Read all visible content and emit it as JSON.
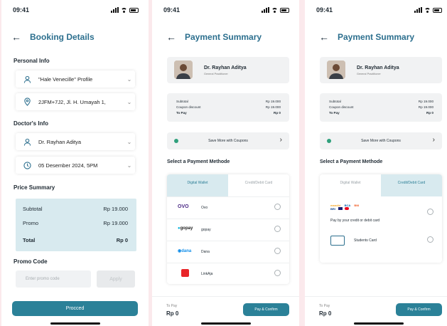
{
  "status": {
    "time": "09:41"
  },
  "booking": {
    "title": "Booking Details",
    "personal_info_label": "Personal Info",
    "profile_value": "\"Hale Venecille\" Profile",
    "address_value": "2JFM+7J2, Jl. H. Umayah 1,",
    "doctor_info_label": "Doctor's Info",
    "doctor_value": "Dr. Rayhan Aditya",
    "date_value": "05 Desember 2024, 5PM",
    "price_summary_label": "Price Summary",
    "subtotal_label": "Subtotal",
    "subtotal_value": "Rp 19.000",
    "promo_label": "Promo",
    "promo_value": "Rp 19.000",
    "total_label": "Total",
    "total_value": "Rp 0",
    "promo_code_label": "Promo Code",
    "promo_placeholder": "Enter promo code",
    "apply_label": "Apply",
    "proceed_label": "Procced"
  },
  "payment": {
    "title": "Payment Summary",
    "doctor_name": "Dr. Rayhan Aditya",
    "doctor_role": "General Practitioner",
    "subtotal_label": "Subtotal",
    "subtotal_value": "Rp 19.000",
    "coupon_label": "Coupon discount",
    "coupon_value": "Rp 19.000",
    "topay_label": "To Pay",
    "topay_value": "Rp 0",
    "coupon_cta": "Save More with Coupons",
    "select_label": "Select a Payment Methode",
    "tab_wallet": "Digital Wallet",
    "tab_card": "Credit/Debit Card",
    "wallets": [
      {
        "logo": "OVO",
        "name": "Ovo",
        "color": "#4c2a86"
      },
      {
        "logo": "gopay",
        "name": "gopay",
        "color": "#00aed6"
      },
      {
        "logo": "dana",
        "name": "Dana",
        "color": "#118ee9"
      },
      {
        "logo": "LinkAja",
        "name": "LinkAja",
        "color": "#e82529"
      }
    ],
    "card_option": "Pay by your credit or debit card",
    "card_brands": [
      "mandiri",
      "BCA",
      "BNI",
      "BRI"
    ],
    "students_option": "Students Card",
    "bottom_topay_label": "To Pay",
    "bottom_topay_value": "Rp 0",
    "confirm_label": "Pay & Confirm"
  }
}
